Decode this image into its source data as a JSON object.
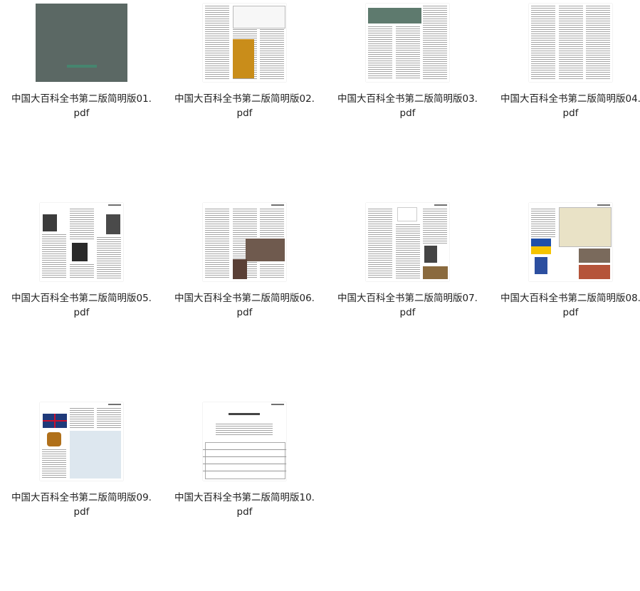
{
  "files": [
    {
      "name_line1": "中国大百科全书第二版简明版01.",
      "name_line2": "pdf"
    },
    {
      "name_line1": "中国大百科全书第二版简明版02.",
      "name_line2": "pdf"
    },
    {
      "name_line1": "中国大百科全书第二版简明版03.",
      "name_line2": "pdf"
    },
    {
      "name_line1": "中国大百科全书第二版简明版04.",
      "name_line2": "pdf"
    },
    {
      "name_line1": "中国大百科全书第二版简明版05.",
      "name_line2": "pdf"
    },
    {
      "name_line1": "中国大百科全书第二版简明版06.",
      "name_line2": "pdf"
    },
    {
      "name_line1": "中国大百科全书第二版简明版07.",
      "name_line2": "pdf"
    },
    {
      "name_line1": "中国大百科全书第二版简明版08.",
      "name_line2": "pdf"
    },
    {
      "name_line1": "中国大百科全书第二版简明版09.",
      "name_line2": "pdf"
    },
    {
      "name_line1": "中国大百科全书第二版简明版10.",
      "name_line2": "pdf"
    }
  ]
}
